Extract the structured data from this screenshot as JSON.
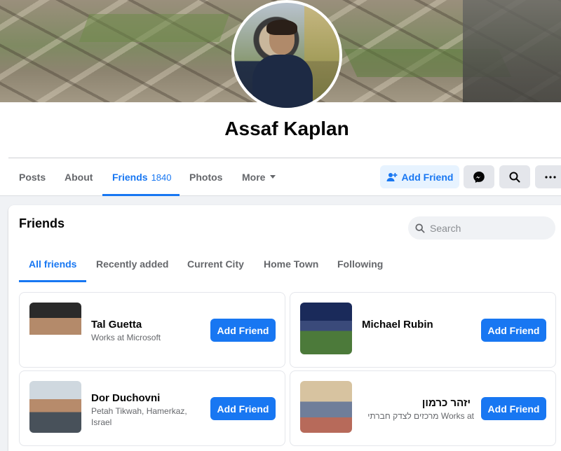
{
  "profile": {
    "name": "Assaf Kaplan"
  },
  "nav": {
    "items": [
      {
        "label": "Posts"
      },
      {
        "label": "About"
      },
      {
        "label": "Friends",
        "count": "1840"
      },
      {
        "label": "Photos"
      },
      {
        "label": "More"
      }
    ],
    "add_friend_label": "Add Friend"
  },
  "friends_section": {
    "title": "Friends",
    "search_placeholder": "Search",
    "tabs": [
      {
        "label": "All friends"
      },
      {
        "label": "Recently added"
      },
      {
        "label": "Current City"
      },
      {
        "label": "Home Town"
      },
      {
        "label": "Following"
      }
    ],
    "friends": [
      {
        "name": "Tal Guetta",
        "subtitle": "Works at Microsoft",
        "button": "Add Friend"
      },
      {
        "name": "Michael Rubin",
        "subtitle": "",
        "button": "Add Friend"
      },
      {
        "name": "Dor Duchovni",
        "subtitle": "Petah Tikwah, Hamerkaz, Israel",
        "button": "Add Friend"
      },
      {
        "name": "יזהר כרמון",
        "subtitle": "Works at מרכזים לצדק חברתי",
        "button": "Add Friend"
      }
    ]
  },
  "colors": {
    "accent": "#1877f2",
    "accent_light": "#e7f3ff",
    "page_bg": "#f0f2f5",
    "secondary_text": "#65676b"
  }
}
